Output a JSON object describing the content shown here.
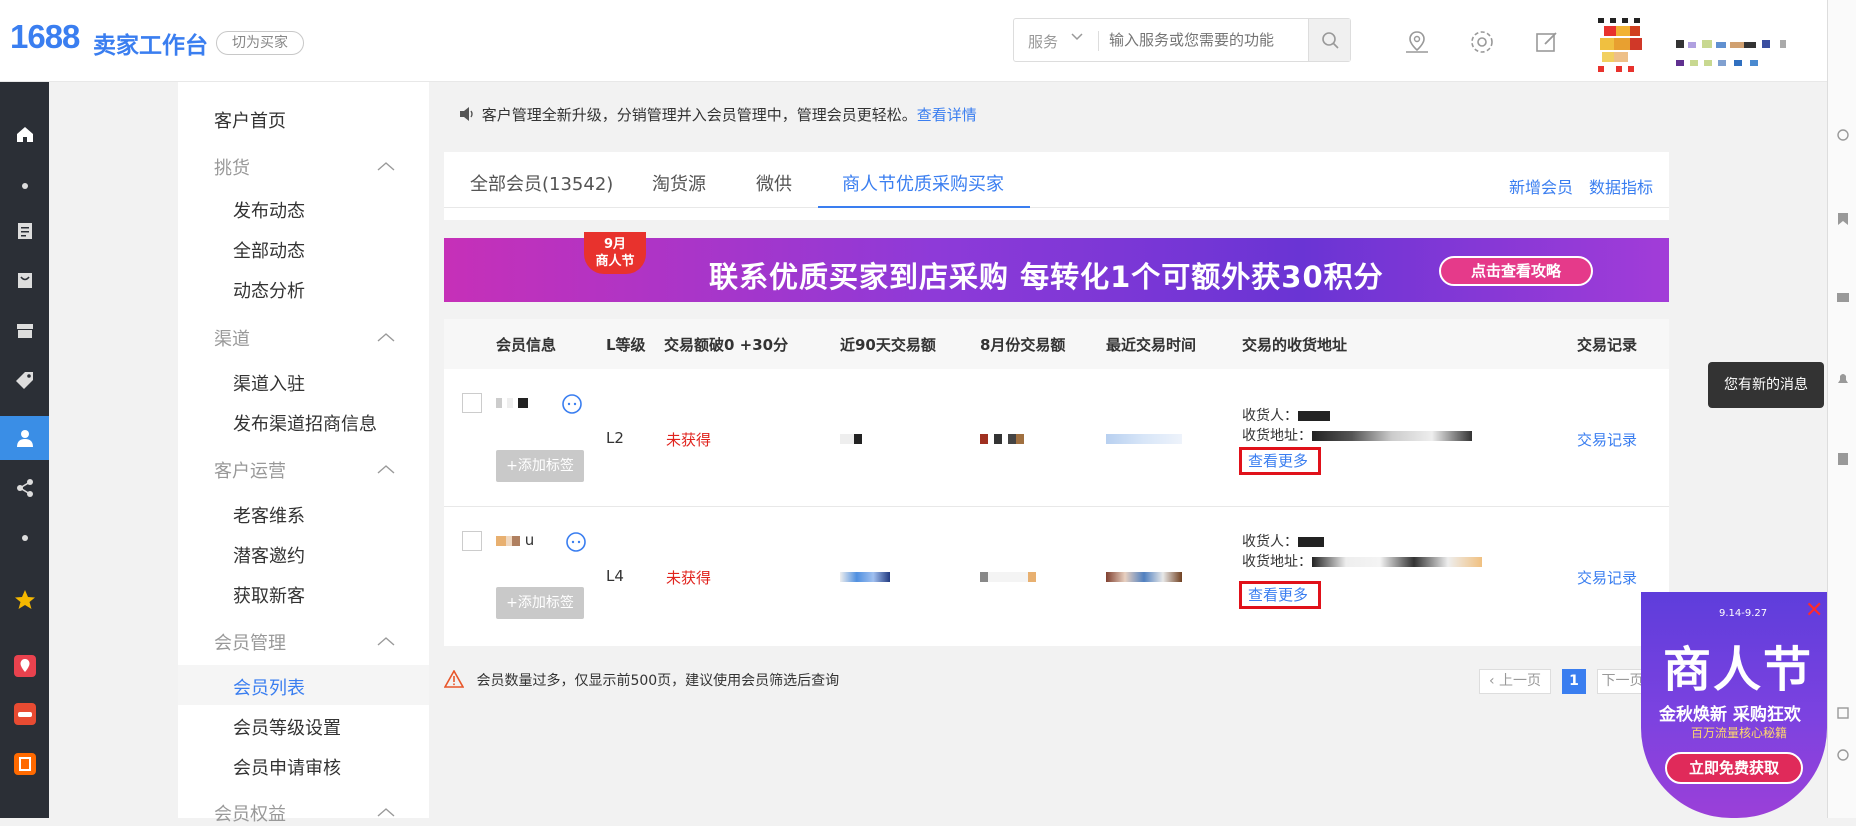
{
  "header": {
    "logo_num": "1688",
    "logo_text": "卖家工作台",
    "switch_label": "切为买家",
    "search_select": "服务",
    "search_placeholder": "输入服务或您需要的功能"
  },
  "sidenav": {
    "home": "客户首页",
    "groups": [
      {
        "label": "挑货",
        "items": [
          "发布动态",
          "全部动态",
          "动态分析"
        ]
      },
      {
        "label": "渠道",
        "items": [
          "渠道入驻",
          "发布渠道招商信息"
        ]
      },
      {
        "label": "客户运营",
        "items": [
          "老客维系",
          "潜客邀约",
          "获取新客"
        ]
      },
      {
        "label": "会员管理",
        "items": [
          "会员列表",
          "会员等级设置",
          "会员申请审核"
        ]
      },
      {
        "label": "会员权益",
        "items": []
      }
    ]
  },
  "notice": {
    "text": "客户管理全新升级，分销管理并入会员管理中，管理会员更轻松。",
    "link": "查看详情"
  },
  "tabs": {
    "items": [
      "全部会员(13542)",
      "淘货源",
      "微供",
      "商人节优质采购买家"
    ],
    "active": 3,
    "right": [
      "新增会员",
      "数据指标"
    ]
  },
  "banner": {
    "badge_line1": "9月",
    "badge_line2": "商人节",
    "text": "联系优质买家到店采购  每转化1个可额外获30积分",
    "button": "点击查看攻略"
  },
  "table": {
    "headers": [
      "会员信息",
      "L等级",
      "交易额破0 +30分",
      "近90天交易额",
      "8月份交易额",
      "最近交易时间",
      "交易的收货地址",
      "交易记录"
    ],
    "rows": [
      {
        "level": "L2",
        "reward": "未获得",
        "consignee_label": "收货人：",
        "address_label": "收货地址：",
        "more": "查看更多",
        "record": "交易记录",
        "tag": "+添加标签"
      },
      {
        "level": "L4",
        "reward": "未获得",
        "consignee_label": "收货人：",
        "address_label": "收货地址：",
        "more": "查看更多",
        "record": "交易记录",
        "tag": "+添加标签",
        "name_suffix": "u"
      }
    ]
  },
  "footer": {
    "warning": "会员数量过多，仅显示前500页，建议使用会员筛选后查询",
    "prev": "上一页",
    "page": "1",
    "next": "下一页"
  },
  "toast": "您有新的消息",
  "promo": {
    "date": "9.14-9.27",
    "title": "商人节",
    "line1": "金秋焕新 采购狂欢",
    "line2": "百万流量核心秘籍",
    "button": "立即免费获取"
  },
  "colors": {
    "accent": "#3a7ef0",
    "sidebar_dark": "#2b2f36",
    "alert_red": "#e0111a"
  }
}
